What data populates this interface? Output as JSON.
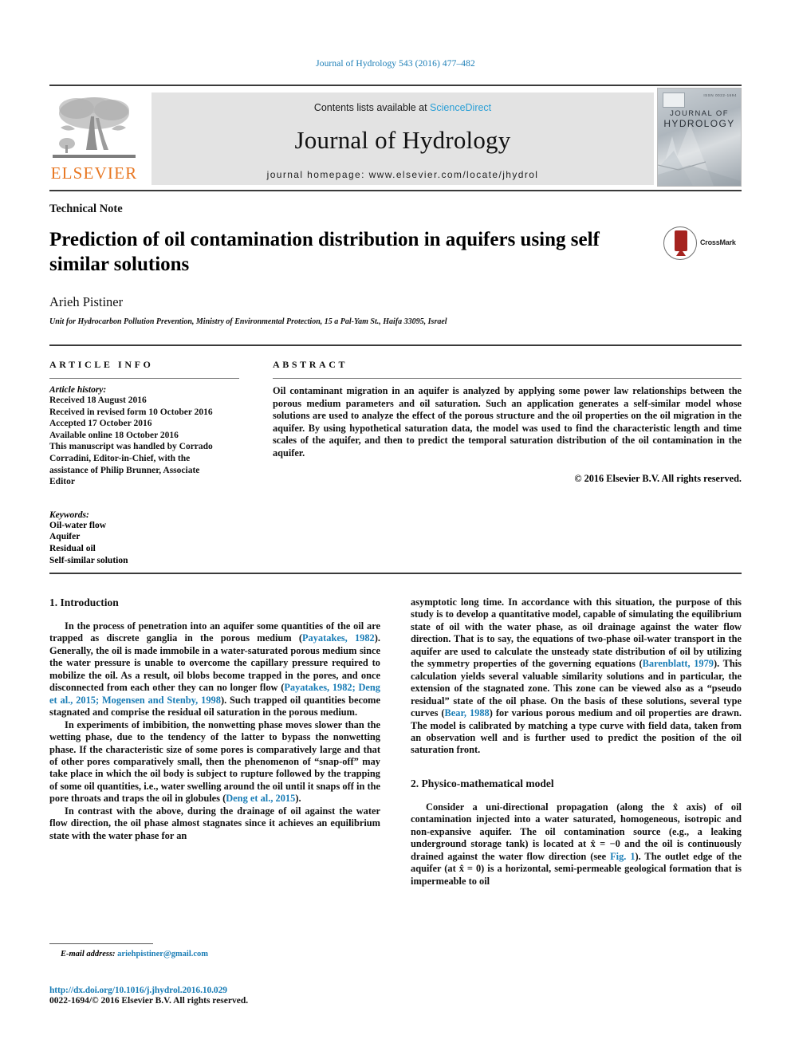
{
  "running_head": "Journal of Hydrology 543 (2016) 477–482",
  "masthead": {
    "contents_prefix": "Contents lists available at ",
    "sciencedirect": "ScienceDirect",
    "journal_name": "Journal of Hydrology",
    "homepage": "journal homepage: www.elsevier.com/locate/jhydrol",
    "publisher_word": "ELSEVIER",
    "cover_title_line1": "JOURNAL OF",
    "cover_title_line2": "HYDROLOGY",
    "cover_code": "ISSN 0022-1694",
    "accent_link": "#2a9fd6",
    "publisher_orange": "#e87722"
  },
  "title_block": {
    "article_type": "Technical Note",
    "title": "Prediction of oil contamination distribution in aquifers using self similar solutions",
    "author": "Arieh Pistiner",
    "affiliation": "Unit for Hydrocarbon Pollution Prevention, Ministry of Environmental Protection, 15 a Pal-Yam St., Haifa 33095, Israel",
    "crossmark_label": "CrossMark"
  },
  "article_info": {
    "label": "ARTICLE INFO",
    "history_heading": "Article history:",
    "history": [
      "Received 18 August 2016",
      "Received in revised form 10 October 2016",
      "Accepted 17 October 2016",
      "Available online 18 October 2016",
      "This manuscript was handled by Corrado",
      "Corradini, Editor-in-Chief, with the",
      "assistance of Philip Brunner, Associate",
      "Editor"
    ],
    "keywords_heading": "Keywords:",
    "keywords": [
      "Oil-water flow",
      "Aquifer",
      "Residual oil",
      "Self-similar solution"
    ]
  },
  "abstract": {
    "label": "ABSTRACT",
    "text": "Oil contaminant migration in an aquifer is analyzed by applying some power law relationships between the porous medium parameters and oil saturation. Such an application generates a self-similar model whose solutions are used to analyze the effect of the porous structure and the oil properties on the oil migration in the aquifer. By using hypothetical saturation data, the model was used to find the characteristic length and time scales of the aquifer, and then to predict the temporal saturation distribution of the oil contamination in the aquifer.",
    "copyright": "© 2016 Elsevier B.V. All rights reserved."
  },
  "body": {
    "left_column": {
      "section_heading": "1. Introduction",
      "paragraphs": [
        {
          "parts": [
            {
              "t": "In the process of penetration into an aquifer some quantities of the oil are trapped as discrete ganglia in the porous medium ("
            },
            {
              "t": "Payatakes, 1982",
              "cite": true
            },
            {
              "t": "). Generally, the oil is made immobile in a water-saturated porous medium since the water pressure is unable to overcome the capillary pressure required to mobilize the oil. As a result, oil blobs become trapped in the pores, and once disconnected from each other they can no longer flow ("
            },
            {
              "t": "Payatakes, 1982; Deng et al., 2015; Mogensen and Stenby, 1998",
              "cite": true
            },
            {
              "t": "). Such trapped oil quantities become stagnated and comprise the residual oil saturation in the porous medium."
            }
          ]
        },
        {
          "parts": [
            {
              "t": "In experiments of imbibition, the nonwetting phase moves slower than the wetting phase, due to the tendency of the latter to bypass the nonwetting phase. If the characteristic size of some pores is comparatively large and that of other pores comparatively small, then the phenomenon of “snap-off” may take place in which the oil body is subject to rupture followed by the trapping of some oil quantities, i.e., water swelling around the oil until it snaps off in the pore throats and traps the oil in globules ("
            },
            {
              "t": "Deng et al., 2015",
              "cite": true
            },
            {
              "t": ")."
            }
          ]
        },
        {
          "parts": [
            {
              "t": "In contrast with the above, during the drainage of oil against the water flow direction, the oil phase almost stagnates since it achieves an equilibrium state with the water phase for an"
            }
          ]
        }
      ]
    },
    "right_column": {
      "paragraphs": [
        {
          "no_indent": true,
          "parts": [
            {
              "t": "asymptotic long time. In accordance with this situation, the purpose of this study is to develop a quantitative model, capable of simulating the equilibrium state of oil with the water phase, as oil drainage against the water flow direction. That is to say, the equations of two-phase oil-water transport in the aquifer are used to calculate the unsteady state distribution of oil by utilizing the symmetry properties of the governing equations ("
            },
            {
              "t": "Barenblatt, 1979",
              "cite": true
            },
            {
              "t": "). This calculation yields several valuable similarity solutions and in particular, the extension of the stagnated zone. This zone can be viewed also as a “pseudo residual” state of the oil phase. On the basis of these solutions, several type curves ("
            },
            {
              "t": "Bear, 1988",
              "cite": true
            },
            {
              "t": ") for various porous medium and oil properties are drawn. The model is calibrated by matching a type curve with field data, taken from an observation well and is further used to predict the position of the oil saturation front."
            }
          ]
        }
      ],
      "section_heading": "2. Physico-mathematical model",
      "paragraphs2": [
        {
          "parts": [
            {
              "t": "Consider a uni-directional propagation (along the x̂ axis) of oil contamination injected into a water saturated, homogeneous, isotropic and non-expansive aquifer. The oil contamination source (e.g., a leaking underground storage tank) is located at x̂ = −0 and the oil is continuously drained against the water flow direction (see "
            },
            {
              "t": "Fig. 1",
              "cite": true
            },
            {
              "t": "). The outlet edge of the aquifer (at x̂ = 0) is a horizontal, semi-permeable geological formation that is impermeable to oil"
            }
          ]
        }
      ]
    }
  },
  "footer": {
    "email_label": "E-mail address:",
    "email": "ariehpistiner@gmail.com",
    "doi": "http://dx.doi.org/10.1016/j.jhydrol.2016.10.029",
    "issn": "0022-1694/© 2016 Elsevier B.V. All rights reserved."
  }
}
